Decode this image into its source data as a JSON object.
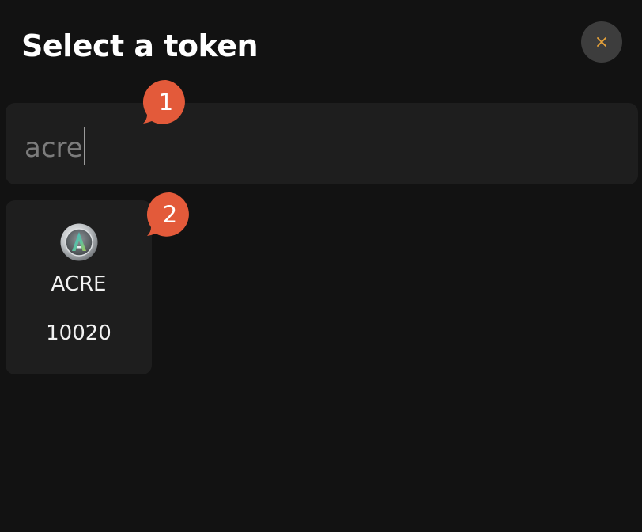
{
  "dialog": {
    "title": "Select a token",
    "close_icon": "close-x-icon",
    "accent_color": "#e8a33a"
  },
  "search": {
    "value": "acre"
  },
  "results": [
    {
      "symbol": "ACRE",
      "asset_id": "10020",
      "icon": "acre-token-logo"
    }
  ],
  "annotations": [
    {
      "label": "1",
      "color": "#e35a3a"
    },
    {
      "label": "2",
      "color": "#e35a3a"
    }
  ]
}
